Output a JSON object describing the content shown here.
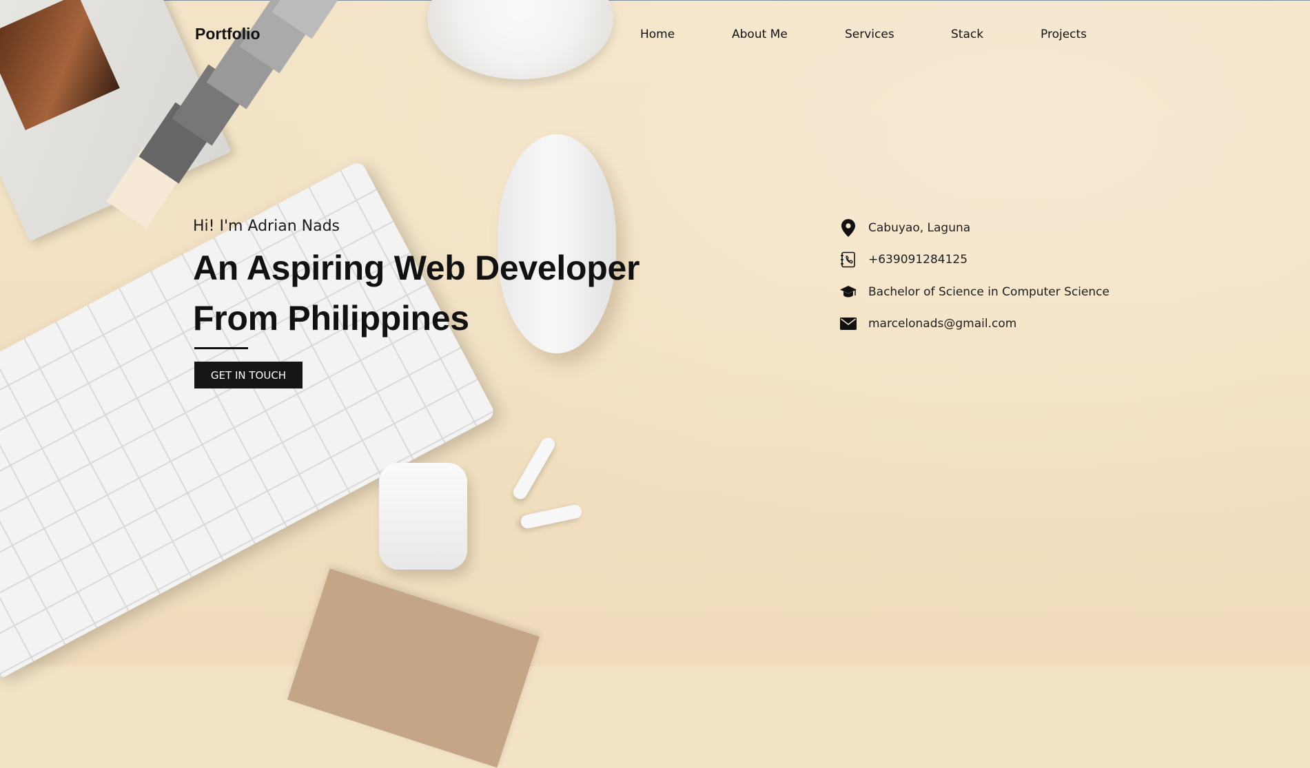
{
  "header": {
    "logo": "Portfolio",
    "nav": [
      "Home",
      "About Me",
      "Services",
      "Stack",
      "Projects"
    ]
  },
  "hero": {
    "greeting": "Hi! I'm Adrian Nads",
    "headline_line1": "An Aspiring Web Developer",
    "headline_line2": "From Philippines",
    "cta_label": "GET IN TOUCH"
  },
  "contact": {
    "location": "Cabuyao, Laguna",
    "phone": "+639091284125",
    "education": "Bachelor of Science in Computer Science",
    "email": "marcelonads@gmail.com"
  },
  "icons": {
    "location": "map-pin-icon",
    "phone": "phone-book-icon",
    "education": "graduation-cap-icon",
    "email": "envelope-icon"
  },
  "colors": {
    "background": "#f3e3c6",
    "text": "#111111",
    "button": "#151515"
  }
}
